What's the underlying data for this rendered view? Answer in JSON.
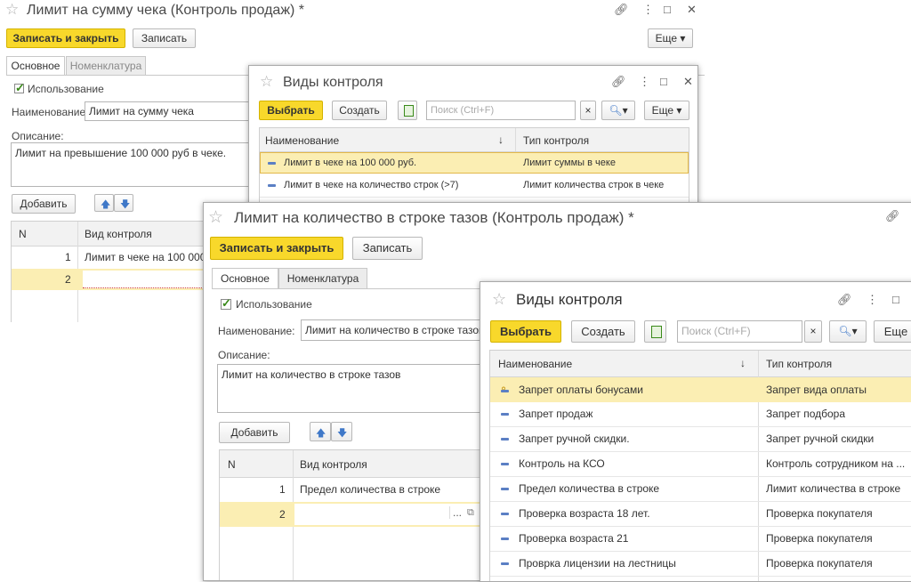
{
  "w1": {
    "title": "Лимит на сумму чека (Контроль продаж) *",
    "save_close": "Записать и закрыть",
    "save": "Записать",
    "more": "Еще ▾",
    "tabs": [
      "Основное",
      "Номенклатура"
    ],
    "use_label": "Использование",
    "name_label": "Наименование:",
    "name_value": "Лимит на сумму чека",
    "desc_label": "Описание:",
    "desc_value": "Лимит на превышение 100 000 руб в чеке.",
    "add": "Добавить",
    "col_n": "N",
    "col_kind": "Вид контроля",
    "rows": [
      {
        "n": "1",
        "kind": "Лимит в чеке на 100 000"
      },
      {
        "n": "2",
        "kind": ""
      }
    ]
  },
  "d1": {
    "title": "Виды контроля",
    "select": "Выбрать",
    "create": "Создать",
    "search_placeholder": "Поиск (Ctrl+F)",
    "clear": "×",
    "search_btn": "▾",
    "more": "Еще ▾",
    "col_name": "Наименование",
    "col_type": "Тип контроля",
    "sort": "↓",
    "rows": [
      {
        "name": "Лимит в чеке на 100 000 руб.",
        "type": "Лимит суммы в чеке"
      },
      {
        "name": "Лимит в чеке на количество строк (>7)",
        "type": "Лимит количества строк в чеке"
      }
    ]
  },
  "w2": {
    "title": "Лимит на количество в строке тазов (Контроль продаж) *",
    "save_close": "Записать и закрыть",
    "save": "Записать",
    "tabs": [
      "Основное",
      "Номенклатура"
    ],
    "use_label": "Использование",
    "name_label": "Наименование:",
    "name_value": "Лимит на количество в строке тазов",
    "desc_label": "Описание:",
    "desc_value": "Лимит на количество в строке тазов",
    "add": "Добавить",
    "col_n": "N",
    "col_kind": "Вид контроля",
    "rows": [
      {
        "n": "1",
        "kind": "Предел количества в строке"
      },
      {
        "n": "2",
        "kind": ""
      }
    ],
    "dots": "..."
  },
  "d2": {
    "title": "Виды контроля",
    "select": "Выбрать",
    "create": "Создать",
    "search_placeholder": "Поиск (Ctrl+F)",
    "clear": "×",
    "search_btn": "▾",
    "more": "Еще",
    "col_name": "Наименование",
    "col_type": "Тип контроля",
    "sort": "↓",
    "rows": [
      {
        "name": "Запрет оплаты бонусами",
        "type": "Запрет вида оплаты"
      },
      {
        "name": "Запрет продаж",
        "type": "Запрет подбора"
      },
      {
        "name": "Запрет ручной скидки.",
        "type": "Запрет ручной скидки"
      },
      {
        "name": "Контроль на КСО",
        "type": "Контроль сотрудником на ..."
      },
      {
        "name": "Предел количества в строке",
        "type": "Лимит количества в строке"
      },
      {
        "name": "Проверка возраста 18 лет.",
        "type": "Проверка покупателя"
      },
      {
        "name": "Проверка возраста 21",
        "type": "Проверка покупателя"
      },
      {
        "name": "Провркa лицензии на лестницы",
        "type": "Проверка покупателя"
      }
    ]
  },
  "colors": {
    "accent_yellow": "#f8d82b",
    "row_highlight": "#fbeeb3",
    "icon_blue": "#3f78c8"
  }
}
